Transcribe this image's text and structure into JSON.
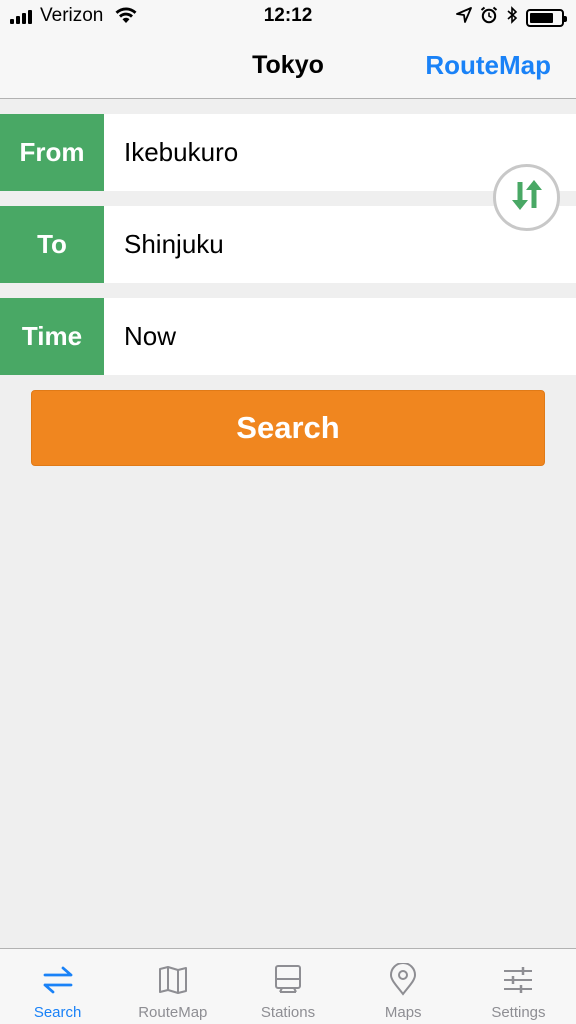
{
  "status_bar": {
    "carrier": "Verizon",
    "time": "12:12",
    "battery_level": 0.75
  },
  "nav": {
    "title": "Tokyo",
    "right_button": "RouteMap"
  },
  "form": {
    "from": {
      "label": "From",
      "value": "Ikebukuro"
    },
    "to": {
      "label": "To",
      "value": "Shinjuku"
    },
    "time": {
      "label": "Time",
      "value": "Now"
    }
  },
  "search_button": "Search",
  "tabs": [
    {
      "label": "Search",
      "icon": "swap-arrows-icon",
      "active": true
    },
    {
      "label": "RouteMap",
      "icon": "folded-map-icon",
      "active": false
    },
    {
      "label": "Stations",
      "icon": "station-board-icon",
      "active": false
    },
    {
      "label": "Maps",
      "icon": "location-pin-icon",
      "active": false
    },
    {
      "label": "Settings",
      "icon": "sliders-icon",
      "active": false
    }
  ],
  "colors": {
    "accent_blue": "#1a82f7",
    "label_green": "#49a865",
    "search_orange": "#f0861f",
    "inactive_gray": "#8e8e93"
  }
}
